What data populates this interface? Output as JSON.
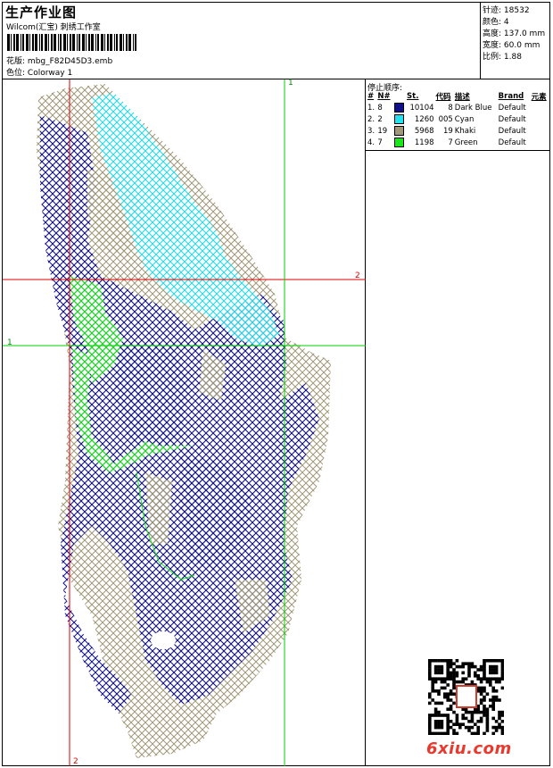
{
  "header": {
    "title": "生产作业图",
    "company": "Wilcom(汇宝) 刺绣工作室",
    "design_label": "花版:",
    "design_name": "mbg_F82D45D3.emb",
    "colorway_label": "色位:",
    "colorway_name": "Colorway 1"
  },
  "stats": {
    "stitches_label": "针迹:",
    "stitches": "18532",
    "colors_label": "颜色:",
    "colors": "4",
    "height_label": "高度:",
    "height": "137.0 mm",
    "width_label": "宽度:",
    "width": "60.0 mm",
    "scale_label": "比例:",
    "scale": "1.88"
  },
  "legend": {
    "title": "停止顺序:",
    "headers": [
      "#",
      "N#",
      "St.",
      "代码",
      "描述",
      "Brand",
      "元素"
    ],
    "rows": [
      {
        "idx": "1.",
        "n": "8",
        "color": "#10108a",
        "st": "10104",
        "code": "8",
        "desc": "Dark Blue",
        "brand": "Default"
      },
      {
        "idx": "2.",
        "n": "2",
        "color": "#22e2f0",
        "st": "1260",
        "code": "005",
        "desc": "Cyan",
        "brand": "Default"
      },
      {
        "idx": "3.",
        "n": "19",
        "color": "#a09878",
        "st": "5968",
        "code": "19",
        "desc": "Khaki",
        "brand": "Default"
      },
      {
        "idx": "4.",
        "n": "7",
        "color": "#18e818",
        "st": "1198",
        "code": "7",
        "desc": "Green",
        "brand": "Default"
      }
    ]
  },
  "guides": {
    "h_red_label": "2",
    "h_green_label": "1",
    "v_red_label": "2",
    "v_green_label": "1"
  },
  "watermark": "6xiu.com"
}
